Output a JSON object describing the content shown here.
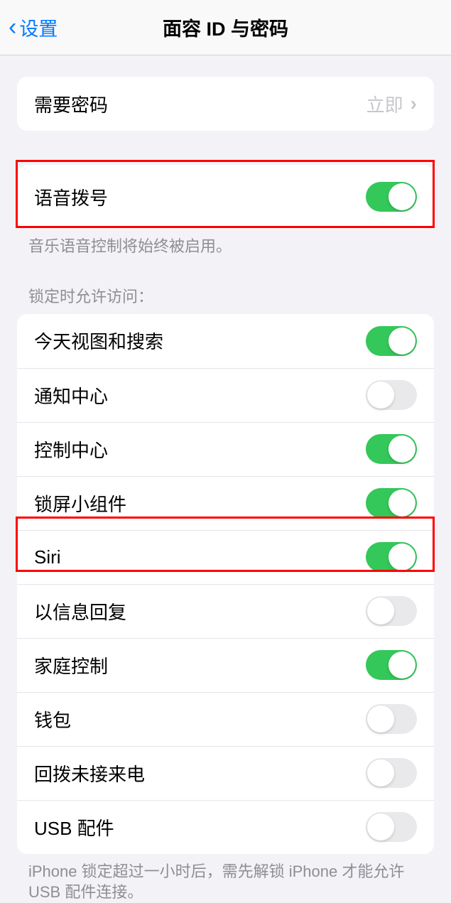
{
  "nav": {
    "back_label": "设置",
    "title": "面容 ID 与密码"
  },
  "require_passcode": {
    "label": "需要密码",
    "value": "立即"
  },
  "voice_dial": {
    "label": "语音拨号",
    "on": true,
    "footer": "音乐语音控制将始终被启用。"
  },
  "lock_access": {
    "header": "锁定时允许访问：",
    "items": [
      {
        "label": "今天视图和搜索",
        "on": true
      },
      {
        "label": "通知中心",
        "on": false
      },
      {
        "label": "控制中心",
        "on": true
      },
      {
        "label": "锁屏小组件",
        "on": true
      },
      {
        "label": "Siri",
        "on": true
      },
      {
        "label": "以信息回复",
        "on": false
      },
      {
        "label": "家庭控制",
        "on": true
      },
      {
        "label": "钱包",
        "on": false
      },
      {
        "label": "回拨未接来电",
        "on": false
      },
      {
        "label": "USB 配件",
        "on": false
      }
    ],
    "footer": "iPhone 锁定超过一小时后，需先解锁 iPhone 才能允许 USB 配件连接。"
  }
}
